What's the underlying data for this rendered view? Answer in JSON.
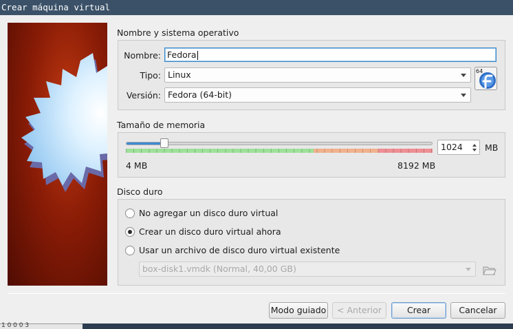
{
  "window": {
    "title": "Crear máquina virtual"
  },
  "taskbar": {
    "fragment": "1 0 0 0 3"
  },
  "name_os": {
    "section_label": "Nombre y sistema operativo",
    "name_label": "Nombre:",
    "name_value": "Fedora",
    "type_label": "Tipo:",
    "type_value": "Linux",
    "version_label": "Versión:",
    "version_value": "Fedora (64-bit)",
    "os_icon": "fedora-64-icon",
    "os_icon_badge": "64"
  },
  "memory": {
    "section_label": "Tamaño de memoria",
    "value": "1024",
    "unit": "MB",
    "min_label": "4 MB",
    "max_label": "8192 MB",
    "slider_fraction": 0.125,
    "zones": {
      "green": "#9fe09a",
      "orange": "#f0b28e",
      "red": "#ef8f95"
    }
  },
  "disk": {
    "section_label": "Disco duro",
    "options": [
      {
        "label": "No agregar un disco duro virtual",
        "selected": false
      },
      {
        "label": "Crear un disco duro virtual ahora",
        "selected": true
      },
      {
        "label": "Usar un archivo de disco duro virtual existente",
        "selected": false
      }
    ],
    "file_value": "box-disk1.vmdk (Normal, 40,00 GB)",
    "folder_icon": "folder-open-icon"
  },
  "buttons": {
    "guided": "Modo guiado",
    "back": "< Anterior",
    "create": "Crear",
    "cancel": "Cancelar"
  },
  "colors": {
    "accent": "#3d8ad2",
    "titlebar": "#3b5168",
    "banner": "#8a1c06"
  }
}
